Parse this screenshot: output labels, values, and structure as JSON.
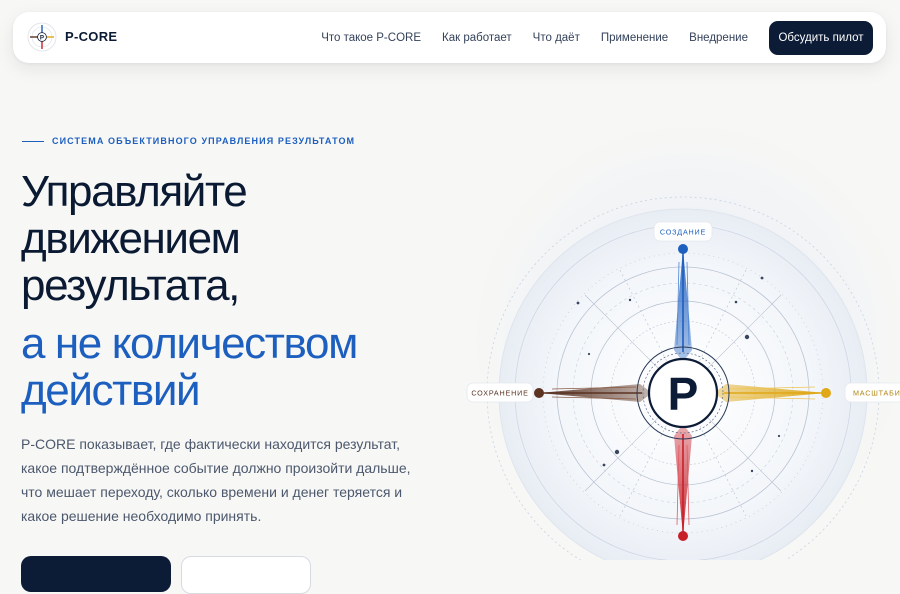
{
  "header": {
    "brand": "P-CORE",
    "nav_items": [
      {
        "label": "Что такое P-CORE"
      },
      {
        "label": "Как работает"
      },
      {
        "label": "Что даёт"
      },
      {
        "label": "Применение"
      },
      {
        "label": "Внедрение"
      }
    ],
    "cta_label": "Обсудить пилот"
  },
  "hero": {
    "eyebrow": "СИСТЕМА ОБЪЕКТИВНОГО УПРАВЛЕНИЯ РЕЗУЛЬТАТОМ",
    "headline_lines": [
      "Управляйте",
      "движением",
      "результата,"
    ],
    "headline_accent_lines": [
      "а не количеством",
      "действий"
    ],
    "lead": "P-CORE показывает, где фактически находится результат, какое подтверждённое событие должно произойти дальше, что мешает переходу, сколько времени и денег теряется и какое решение необходимо принять."
  },
  "compass": {
    "center_letter": "P",
    "labels": {
      "top": "СОЗДАНИЕ",
      "left": "СОХРАНЕНИЕ",
      "right": "МАСШТАБИР"
    },
    "colors": {
      "top": "#1d5fbf",
      "bottom": "#c8202a",
      "left": "#5a3322",
      "right": "#e0a817",
      "core": "#0c1b36"
    }
  },
  "theme": {
    "accent": "#1d5fbf",
    "dark": "#0c1b36",
    "background": "#f7f7f5"
  }
}
